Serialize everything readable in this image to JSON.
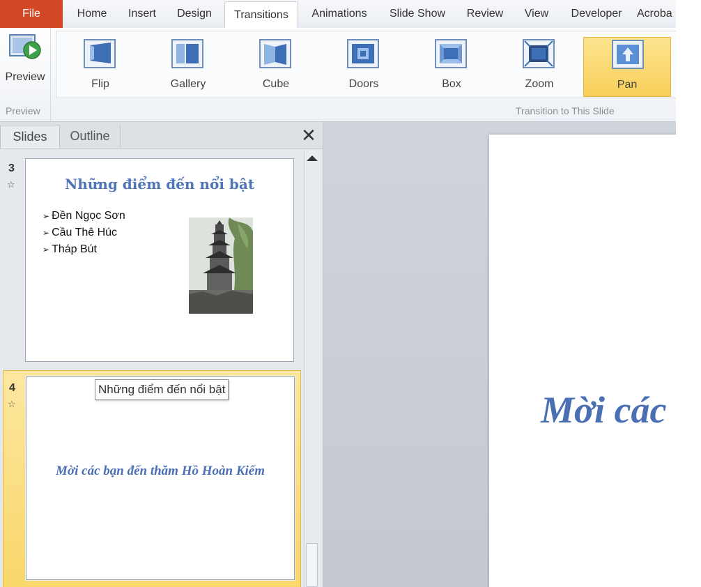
{
  "ribbon": {
    "tabs": [
      "File",
      "Home",
      "Insert",
      "Design",
      "Transitions",
      "Animations",
      "Slide Show",
      "Review",
      "View",
      "Developer",
      "Acroba"
    ],
    "active_tab": "Transitions",
    "preview_button": "Preview",
    "preview_group_label": "Preview",
    "transitions_group_label": "Transition to This Slide",
    "transitions": [
      "Flip",
      "Gallery",
      "Cube",
      "Doors",
      "Box",
      "Zoom",
      "Pan"
    ],
    "selected_transition": "Pan"
  },
  "slides_pane": {
    "tabs": [
      "Slides",
      "Outline"
    ],
    "active_tab": "Slides",
    "close_glyph": "✕",
    "slides": [
      {
        "number": "3",
        "title": "Những điểm đến nổi bật",
        "bullets": [
          "Đền Ngọc Sơn",
          "Cầu Thê Húc",
          "Tháp Bút"
        ],
        "image": "pagoda-tower-photo"
      },
      {
        "number": "4",
        "text": "Mời các bạn đến thăm Hồ Hoàn Kiếm",
        "tooltip": "Những điểm đến nổi bật",
        "selected": true
      }
    ]
  },
  "editor": {
    "visible_text": "Mời các"
  }
}
